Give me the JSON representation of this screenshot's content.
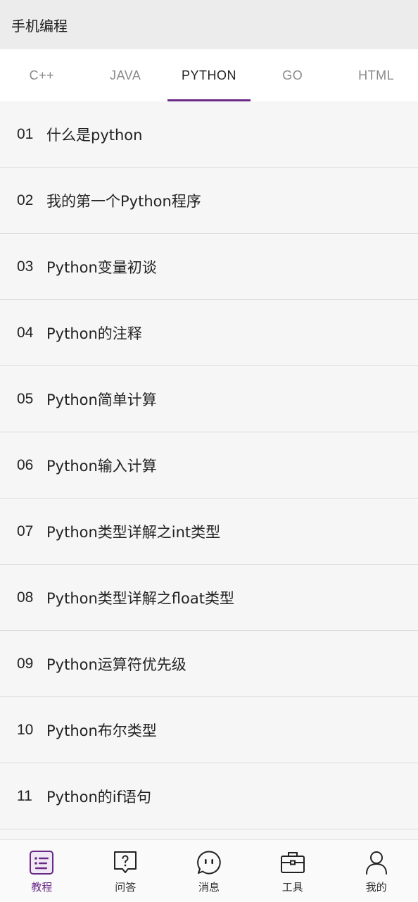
{
  "app": {
    "title": "手机编程"
  },
  "tabs": [
    {
      "label": "C++",
      "active": false
    },
    {
      "label": "JAVA",
      "active": false
    },
    {
      "label": "PYTHON",
      "active": true
    },
    {
      "label": "GO",
      "active": false
    },
    {
      "label": "HTML",
      "active": false
    }
  ],
  "lessons": [
    {
      "num": "01",
      "title": "什么是python"
    },
    {
      "num": "02",
      "title": "我的第一个Python程序"
    },
    {
      "num": "03",
      "title": "Python变量初谈"
    },
    {
      "num": "04",
      "title": "Python的注释"
    },
    {
      "num": "05",
      "title": "Python简单计算"
    },
    {
      "num": "06",
      "title": "Python输入计算"
    },
    {
      "num": "07",
      "title": "Python类型详解之int类型"
    },
    {
      "num": "08",
      "title": "Python类型详解之float类型"
    },
    {
      "num": "09",
      "title": "Python运算符优先级"
    },
    {
      "num": "10",
      "title": "Python布尔类型"
    },
    {
      "num": "11",
      "title": "Python的if语句"
    }
  ],
  "bottom_nav": [
    {
      "label": "教程",
      "icon": "tutorial-list-icon",
      "active": true
    },
    {
      "label": "问答",
      "icon": "question-bubble-icon",
      "active": false
    },
    {
      "label": "消息",
      "icon": "message-chat-icon",
      "active": false
    },
    {
      "label": "工具",
      "icon": "toolbox-icon",
      "active": false
    },
    {
      "label": "我的",
      "icon": "user-profile-icon",
      "active": false
    }
  ],
  "colors": {
    "accent": "#6a2a86",
    "appbar_bg": "#ececec",
    "list_bg": "#f6f6f6",
    "divider": "#dcdcdc"
  }
}
